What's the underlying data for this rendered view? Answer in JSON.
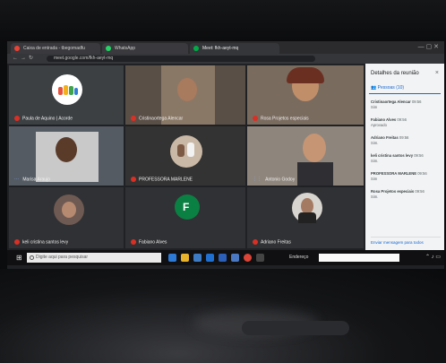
{
  "browser": {
    "tabs": [
      {
        "label": "Caixa de entrada - tbegomadfu",
        "color": "#ea4335"
      },
      {
        "label": "WhatsApp",
        "color": "#25d366"
      },
      {
        "label": "Meet: fkh-aeyt-mq",
        "color": "#00ac47"
      }
    ],
    "url": "meet.google.com/fkh-aeyt-mq"
  },
  "meet": {
    "participants": [
      {
        "name": "Paula de Aquino | Acorde",
        "mic": "muted"
      },
      {
        "name": "Cristinaortega Alencar",
        "mic": "muted"
      },
      {
        "name": "Rosa Projetos especiais",
        "mic": "muted"
      },
      {
        "name": "Marisa Araujo",
        "mic": "on"
      },
      {
        "name": "PROFESSORA MARLENE",
        "mic": "muted"
      },
      {
        "name": "Antonio Godoy",
        "mic": "on"
      },
      {
        "name": "keli cristina santos levy",
        "mic": "muted"
      },
      {
        "name": "Fabiano Alves",
        "mic": "muted"
      },
      {
        "name": "Adriano Freitas",
        "mic": "muted"
      }
    ],
    "avatar_letter": "F",
    "avatar_color": "#0b8043"
  },
  "panel": {
    "title": "Detalhes da reunião",
    "close": "×",
    "people_tab": "Pessoas (10)",
    "messages": [
      {
        "name": "Cristinaortega Alencar",
        "time": "09:56",
        "text": "Sim"
      },
      {
        "name": "Fabiano Alves",
        "time": "09:56",
        "text": "Aprovado"
      },
      {
        "name": "Adriano Freitas",
        "time": "09:56",
        "text": "Sim."
      },
      {
        "name": "keli cristina santos levy",
        "time": "09:56",
        "text": "Sim."
      },
      {
        "name": "PROFESSORA MARLENE",
        "time": "09:56",
        "text": "Sim"
      },
      {
        "name": "Rosa Projetos especiais",
        "time": "09:56",
        "text": "Sim."
      }
    ],
    "compose_placeholder": "Enviar mensagem para todos"
  },
  "taskbar": {
    "search_placeholder": "Digite aqui para pesquisar",
    "address_label": "Endereço"
  }
}
